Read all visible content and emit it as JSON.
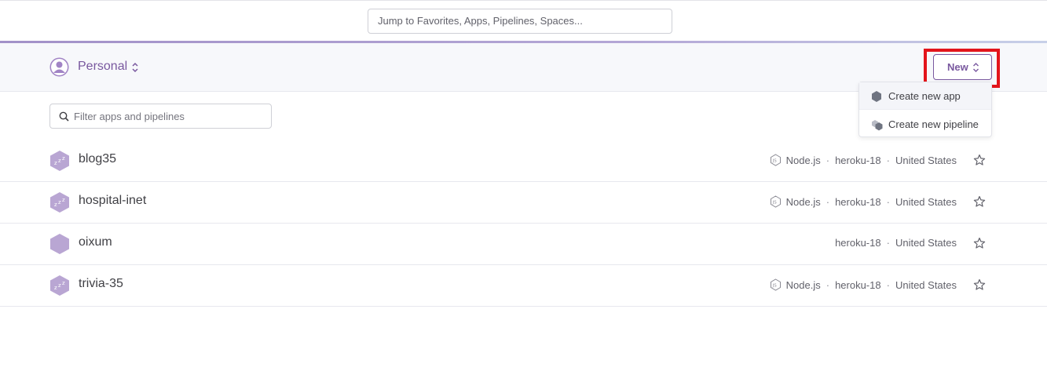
{
  "search": {
    "placeholder": "Jump to Favorites, Apps, Pipelines, Spaces..."
  },
  "context": {
    "label": "Personal"
  },
  "new_button": {
    "label": "New"
  },
  "filter": {
    "placeholder": "Filter apps and pipelines"
  },
  "dropdown": {
    "items": [
      {
        "label": "Create new app",
        "icon": "hexagon-icon"
      },
      {
        "label": "Create new pipeline",
        "icon": "pipeline-icon"
      }
    ]
  },
  "apps": [
    {
      "name": "blog35",
      "language": "Node.js",
      "stack": "heroku-18",
      "region": "United States",
      "sleeping": true
    },
    {
      "name": "hospital-inet",
      "language": "Node.js",
      "stack": "heroku-18",
      "region": "United States",
      "sleeping": true
    },
    {
      "name": "oixum",
      "language": "",
      "stack": "heroku-18",
      "region": "United States",
      "sleeping": false
    },
    {
      "name": "trivia-35",
      "language": "Node.js",
      "stack": "heroku-18",
      "region": "United States",
      "sleeping": true
    }
  ],
  "colors": {
    "brand": "#79589f",
    "highlight": "#e3151b",
    "hex": "#b9a6d3"
  }
}
